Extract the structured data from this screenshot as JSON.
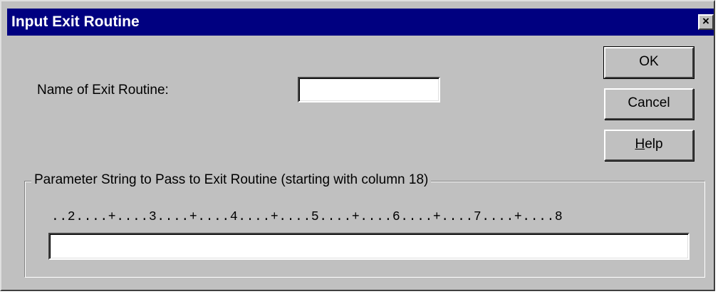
{
  "dialog": {
    "title": "Input Exit Routine",
    "close_symbol": "×"
  },
  "exit_routine": {
    "label": "Name of Exit Routine:",
    "value": ""
  },
  "buttons": {
    "ok": "OK",
    "cancel": "Cancel",
    "help_mnemonic": "H",
    "help_rest": "elp"
  },
  "parameter_group": {
    "legend": "Parameter String to Pass to Exit Routine (starting with column 18)",
    "ruler": "..2....+....3....+....4....+....5....+....6....+....7....+....8",
    "value": ""
  },
  "icons": {
    "close": "close-icon"
  }
}
